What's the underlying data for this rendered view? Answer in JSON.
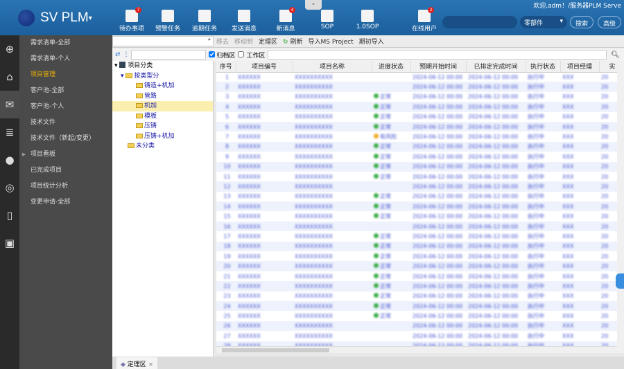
{
  "header": {
    "app_title": "SV PLM",
    "welcome": "欢迎,adm！/服务器PLM Serve",
    "toolbar": [
      {
        "label": "待办事项",
        "icon": "todo-icon",
        "badge": "7"
      },
      {
        "label": "预警任务",
        "icon": "warning-task-icon"
      },
      {
        "label": "逾期任务",
        "icon": "overdue-task-icon"
      },
      {
        "label": "发送消息",
        "icon": "send-message-icon"
      },
      {
        "label": "新消息",
        "icon": "new-message-icon",
        "badge": "4"
      },
      {
        "label": "SOP",
        "icon": "book-icon"
      },
      {
        "label": "1.0SOP",
        "icon": "book-icon"
      },
      {
        "label": "在线用户",
        "icon": "online-users-icon",
        "badge": "2"
      }
    ],
    "search_type": "零部件",
    "search_button": "搜索",
    "advanced_button": "高级"
  },
  "menu": {
    "items": [
      {
        "label": "需求清单-全部"
      },
      {
        "label": "需求清单-个人"
      },
      {
        "label": "项目管理",
        "active": true
      },
      {
        "label": "客户池-全部"
      },
      {
        "label": "客户池-个人"
      },
      {
        "label": "技术文件"
      },
      {
        "label": "技术文件（新起/变更）"
      },
      {
        "label": "项目看板",
        "expandable": true
      },
      {
        "label": "已完成项目"
      },
      {
        "label": "项目统计分析"
      },
      {
        "label": "变更申请-全部"
      }
    ]
  },
  "toolbar": {
    "delete": "移去",
    "move": "移动到",
    "locate": "定理区",
    "refresh": "刷新",
    "import_ms": "导入MS Project",
    "import_initial": "期初导入",
    "archive": "归档区",
    "work": "工作区",
    "archive_checked": true,
    "work_checked": false
  },
  "tree": {
    "root": "项目分类",
    "group": "按类型分",
    "children": [
      "铸造+机加",
      "管路",
      "机加",
      "模板",
      "压铸",
      "压铸+机加"
    ],
    "selected": "机加",
    "other": "未分类"
  },
  "table": {
    "columns": [
      "序号",
      "项目编号",
      "项目名称",
      "进度状态",
      "预期开始时间",
      "已排定完成时间",
      "执行状态",
      "项目经理",
      "实"
    ],
    "status_ok": "正常",
    "status_risk": "有风险",
    "rows_status": [
      "",
      "",
      "ok",
      "ok",
      "ok",
      "ok",
      "risk",
      "ok",
      "ok",
      "ok",
      "ok",
      "",
      "ok",
      "ok",
      "ok",
      "",
      "ok",
      "ok",
      "ok",
      "ok",
      "ok",
      "ok",
      "ok",
      "ok",
      "ok",
      "",
      "",
      "",
      ""
    ],
    "blurred_code": "XXXXXX",
    "blurred_name": "XXXXXXXXXX",
    "blurred_date": "2024-06-12 00:00",
    "blurred_exec": "执行中",
    "blurred_pm": "XXX",
    "blurred_extra": "20"
  },
  "bottom_tab": "定理区",
  "colors": {
    "header": "#1e66a6",
    "menu_bg": "#4a4a4a",
    "active_menu": "#f0b400",
    "link": "#1a1aa8"
  }
}
